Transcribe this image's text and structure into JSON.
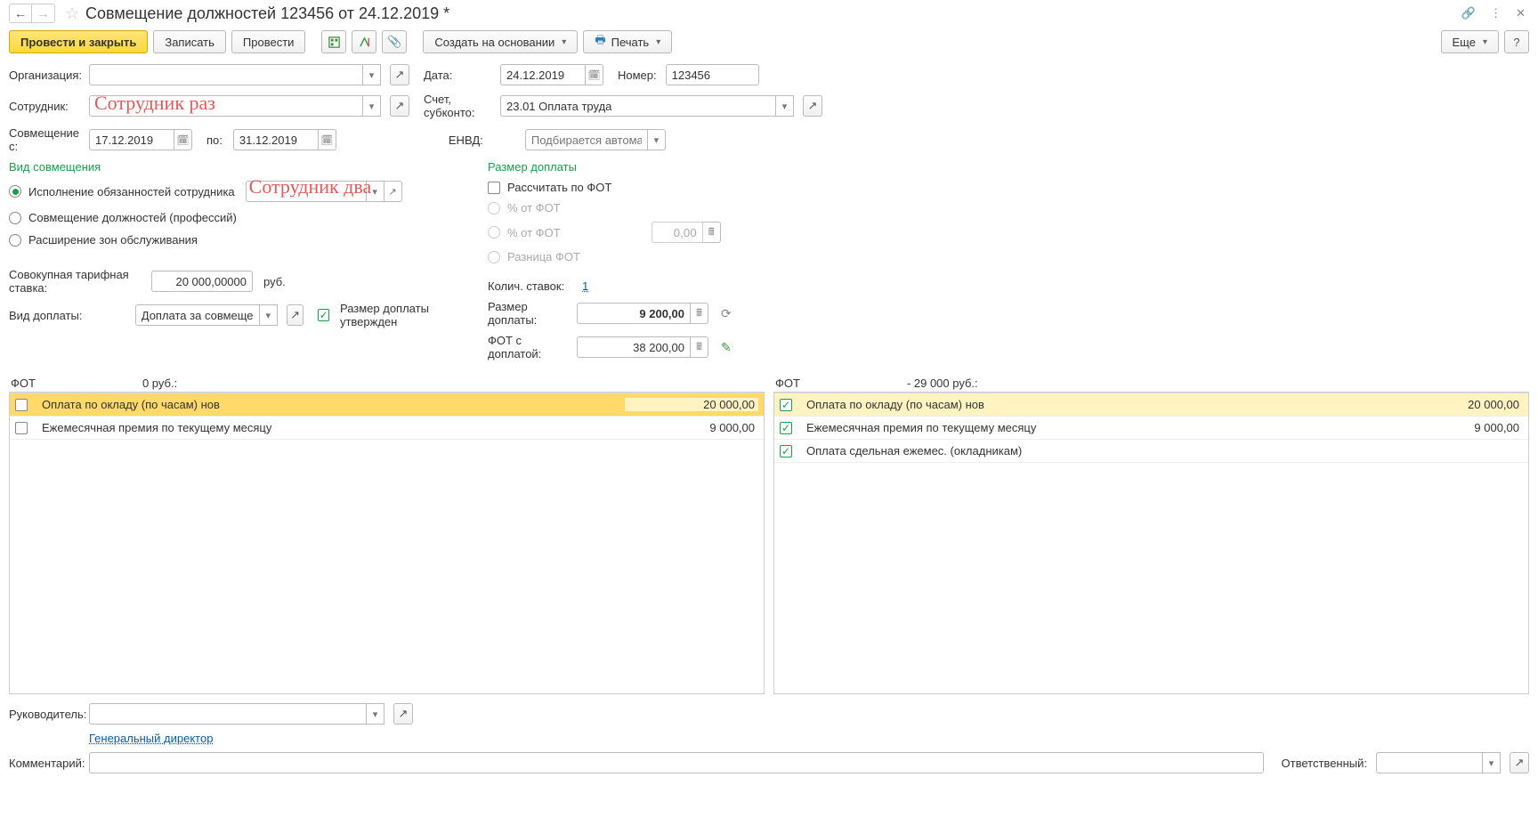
{
  "title": "Совмещение должностей 123456 от 24.12.2019 *",
  "toolbar": {
    "post_close": "Провести и закрыть",
    "save": "Записать",
    "post": "Провести",
    "create_based": "Создать на основании",
    "print": "Печать",
    "more": "Еще",
    "help": "?"
  },
  "handwriting": {
    "emp": "Сотрудник раз",
    "dep": "Сотрудник два"
  },
  "labels": {
    "org": "Организация:",
    "date": "Дата:",
    "number": "Номер:",
    "employee": "Сотрудник:",
    "account": "Счет, субконто:",
    "combine_from": "Совмещение с:",
    "to": "по:",
    "envd": "ЕНВД:",
    "envd_placeholder": "Подбирается автомати...",
    "kind_section": "Вид совмещения",
    "pay_section": "Размер доплаты",
    "r1": "Исполнение обязанностей сотрудника",
    "r2": "Совмещение должностей (профессий)",
    "r3": "Расширение зон обслуживания",
    "calc_fot": "Рассчитать по ФОТ",
    "pct_fot": "% от ФОТ",
    "diff_fot": "Разница ФОТ",
    "rate": "Совокупная тарифная ставка:",
    "rate_suffix": "руб.",
    "count": "Колич. ставок:",
    "dopl_kind": "Вид доплаты:",
    "dopl_approved": "Размер доплаты утвержден",
    "dopl_size": "Размер доплаты:",
    "fot_with": "ФОТ с доплатой:",
    "fot_left": "ФОТ",
    "fot_left_val": "0 руб.:",
    "fot_right": "ФОТ",
    "fot_right_val": "- 29 000 руб.:",
    "manager": "Руководитель:",
    "manager_link": "Генеральный директор",
    "comment": "Комментарий:",
    "responsible": "Ответственный:"
  },
  "values": {
    "org": "",
    "date": "24.12.2019",
    "number": "123456",
    "employee": "",
    "account": "23.01 Оплата труда",
    "from": "17.12.2019",
    "to": "31.12.2019",
    "rate": "20 000,00000",
    "count": "1",
    "dopl_kind": "Доплата за совмещение с",
    "dopl_size": "9 200,00",
    "fot_with": "38 200,00",
    "pct_fot": "0,00",
    "manager": "",
    "comment": "",
    "responsible": ""
  },
  "table_left": {
    "rows": [
      {
        "checked": false,
        "name": "Оплата по окладу (по часам) нов",
        "value": "20 000,00",
        "active": true
      },
      {
        "checked": false,
        "name": "Ежемесячная премия по текущему месяцу",
        "value": "9 000,00"
      }
    ]
  },
  "table_right": {
    "rows": [
      {
        "checked": true,
        "name": "Оплата по окладу (по часам) нов",
        "value": "20 000,00",
        "active": true
      },
      {
        "checked": true,
        "name": "Ежемесячная премия по текущему месяцу",
        "value": "9 000,00"
      },
      {
        "checked": true,
        "name": "Оплата сдельная ежемес. (окладникам)",
        "value": ""
      }
    ]
  }
}
